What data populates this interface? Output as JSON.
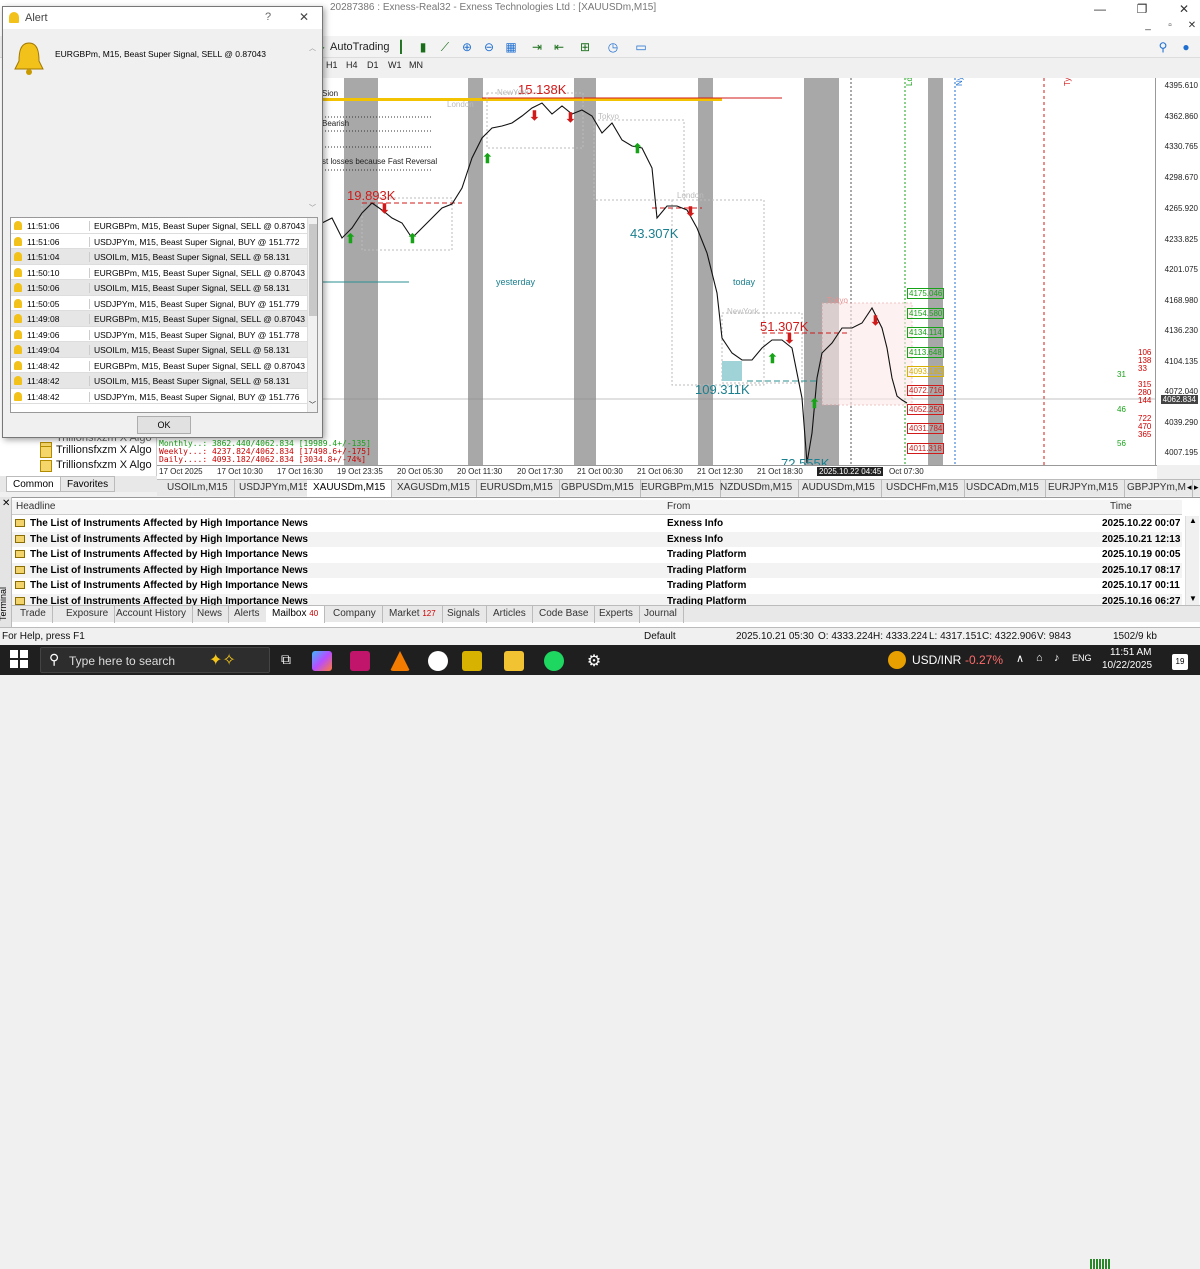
{
  "window": {
    "title": "20287386 : Exness-Real32 - Exness Technologies Ltd : [XAUUSDm,M15]"
  },
  "toolbar": {
    "autotrading_label": "AutoTrading"
  },
  "timeframes": [
    "H1",
    "H4",
    "D1",
    "W1",
    "MN"
  ],
  "navigator": {
    "items": [
      "Trillionsfxzm X Algo",
      "Trillionsfxzm X Algo",
      "Trillionsfxzm X Algo"
    ],
    "tabs": [
      "Common",
      "Favorites"
    ]
  },
  "alert_dialog": {
    "title": "Alert",
    "help": "?",
    "close": "✕",
    "main_message": "EURGBPm, M15, Beast Super Signal, SELL @ 0.87043",
    "ok_label": "OK",
    "rows": [
      {
        "time": "11:51:06",
        "msg": "EURGBPm, M15, Beast Super Signal, SELL @ 0.87043"
      },
      {
        "time": "11:51:06",
        "msg": "USDJPYm, M15, Beast Super Signal, BUY @ 151.772"
      },
      {
        "time": "11:51:04",
        "msg": "USOILm, M15, Beast Super Signal, SELL @ 58.131"
      },
      {
        "time": "11:50:10",
        "msg": "EURGBPm, M15, Beast Super Signal, SELL @ 0.87043"
      },
      {
        "time": "11:50:06",
        "msg": "USOILm, M15, Beast Super Signal, SELL @ 58.131"
      },
      {
        "time": "11:50:05",
        "msg": "USDJPYm, M15, Beast Super Signal, BUY @ 151.779"
      },
      {
        "time": "11:49:08",
        "msg": "EURGBPm, M15, Beast Super Signal, SELL @ 0.87043"
      },
      {
        "time": "11:49:06",
        "msg": "USDJPYm, M15, Beast Super Signal, BUY @ 151.778"
      },
      {
        "time": "11:49:04",
        "msg": "USOILm, M15, Beast Super Signal, SELL @ 58.131"
      },
      {
        "time": "11:48:42",
        "msg": "EURGBPm, M15, Beast Super Signal, SELL @ 0.87043"
      },
      {
        "time": "11:48:42",
        "msg": "USOILm, M15, Beast Super Signal, SELL @ 58.131"
      },
      {
        "time": "11:48:42",
        "msg": "USDJPYm, M15, Beast Super Signal, BUY @ 151.776"
      }
    ]
  },
  "chart": {
    "price_labels": [
      "4395.610",
      "4362.860",
      "4330.765",
      "4298.670",
      "4265.920",
      "4233.825",
      "4201.075",
      "4168.980",
      "4136.230",
      "4104.135",
      "4072.040",
      "4039.290",
      "4007.195"
    ],
    "current_price": "4062.834",
    "time_labels": [
      "17 Oct 2025",
      "17 Oct 10:30",
      "17 Oct 16:30",
      "19 Oct 23:35",
      "20 Oct 05:30",
      "20 Oct 11:30",
      "20 Oct 17:30",
      "21 Oct 00:30",
      "21 Oct 06:30",
      "21 Oct 12:30",
      "21 Oct 18:30",
      "2025.10.22 04:45",
      "Oct 07:30"
    ],
    "annotations": {
      "high": "15.138K",
      "a1": "19.893K",
      "a2": "43.307K",
      "a3": "51.307K",
      "a4": "109.311K",
      "a5": "72.555K",
      "yesterday": "yesterday",
      "today": "today",
      "london": "London",
      "newyork": "NewYork",
      "tokyo": "Tokyo",
      "ldn": "Ldn",
      "nyc": "Nyc",
      "tyo": "Tyo",
      "bearish": "Bearish",
      "fast_reversal": "st losses because Fast Reversal",
      "session": "Sion"
    },
    "levels": [
      "4175.046",
      "4154.580",
      "4134.114",
      "4113.648",
      "4093.182",
      "4072.716",
      "4052.250",
      "4031.784",
      "4011.318"
    ],
    "right_numbers": [
      "106",
      "138",
      "33",
      "31",
      "315",
      "280",
      "144",
      "46",
      "722",
      "470",
      "365",
      "56"
    ],
    "info_lines": [
      "Monthly..: 3862.440/4062.834 [19989.4+/-135]",
      "Weekly...: 4237.824/4062.834 [17498.6+/-175]",
      "Daily....: 4093.182/4062.834 [3034.8+/-74%]"
    ]
  },
  "symbol_tabs": [
    "USOILm,M15",
    "USDJPYm,M15",
    "XAUUSDm,M15",
    "XAGUSDm,M15",
    "EURUSDm,M15",
    "GBPUSDm,M15",
    "EURGBPm,M15",
    "NZDUSDm,M15",
    "AUDUSDm,M15",
    "USDCHFm,M15",
    "USDCADm,M15",
    "EURJPYm,M15",
    "GBPJPYm,M"
  ],
  "terminal": {
    "side_label": "Terminal",
    "columns": {
      "headline": "Headline",
      "from": "From",
      "time": "Time"
    },
    "rows": [
      {
        "headline": "The List of Instruments Affected by High Importance News",
        "from": "Exness Info",
        "time": "2025.10.22 00:07"
      },
      {
        "headline": "The List of Instruments Affected by High Importance News",
        "from": "Exness Info",
        "time": "2025.10.21 12:13"
      },
      {
        "headline": "The List of Instruments Affected by High Importance News",
        "from": "Trading Platform",
        "time": "2025.10.19 00:05"
      },
      {
        "headline": "The List of Instruments Affected by High Importance News",
        "from": "Trading Platform",
        "time": "2025.10.17 08:17"
      },
      {
        "headline": "The List of Instruments Affected by High Importance News",
        "from": "Trading Platform",
        "time": "2025.10.17 00:11"
      },
      {
        "headline": "The List of Instruments Affected by High Importance News",
        "from": "Trading Platform",
        "time": "2025.10.16 06:27"
      }
    ],
    "tabs": [
      {
        "label": "Trade",
        "badge": ""
      },
      {
        "label": "Exposure",
        "badge": ""
      },
      {
        "label": "Account History",
        "badge": ""
      },
      {
        "label": "News",
        "badge": ""
      },
      {
        "label": "Alerts",
        "badge": ""
      },
      {
        "label": "Mailbox",
        "badge": "40"
      },
      {
        "label": "Company",
        "badge": ""
      },
      {
        "label": "Market",
        "badge": "127"
      },
      {
        "label": "Signals",
        "badge": ""
      },
      {
        "label": "Articles",
        "badge": ""
      },
      {
        "label": "Code Base",
        "badge": ""
      },
      {
        "label": "Experts",
        "badge": ""
      },
      {
        "label": "Journal",
        "badge": ""
      }
    ]
  },
  "status": {
    "help": "For Help, press F1",
    "profile": "Default",
    "datetime": "2025.10.21 05:30",
    "open": "O: 4333.224",
    "high": "H: 4333.224",
    "low": "L: 4317.151",
    "close": "C: 4322.906",
    "volume": "V: 9843",
    "traffic": "1502/9 kb"
  },
  "taskbar": {
    "search_placeholder": "Type here to search",
    "ticker": "USD/INR",
    "ticker_change": "-0.27%",
    "lang": "ENG",
    "time": "11:51 AM",
    "date": "10/22/2025",
    "notifications": "19"
  },
  "colors": {
    "bull": "#17a317",
    "bear": "#d11a1a",
    "accent": "#1f6fd0",
    "session_band": "#a8a8a8",
    "level_band": "#f3c200"
  }
}
